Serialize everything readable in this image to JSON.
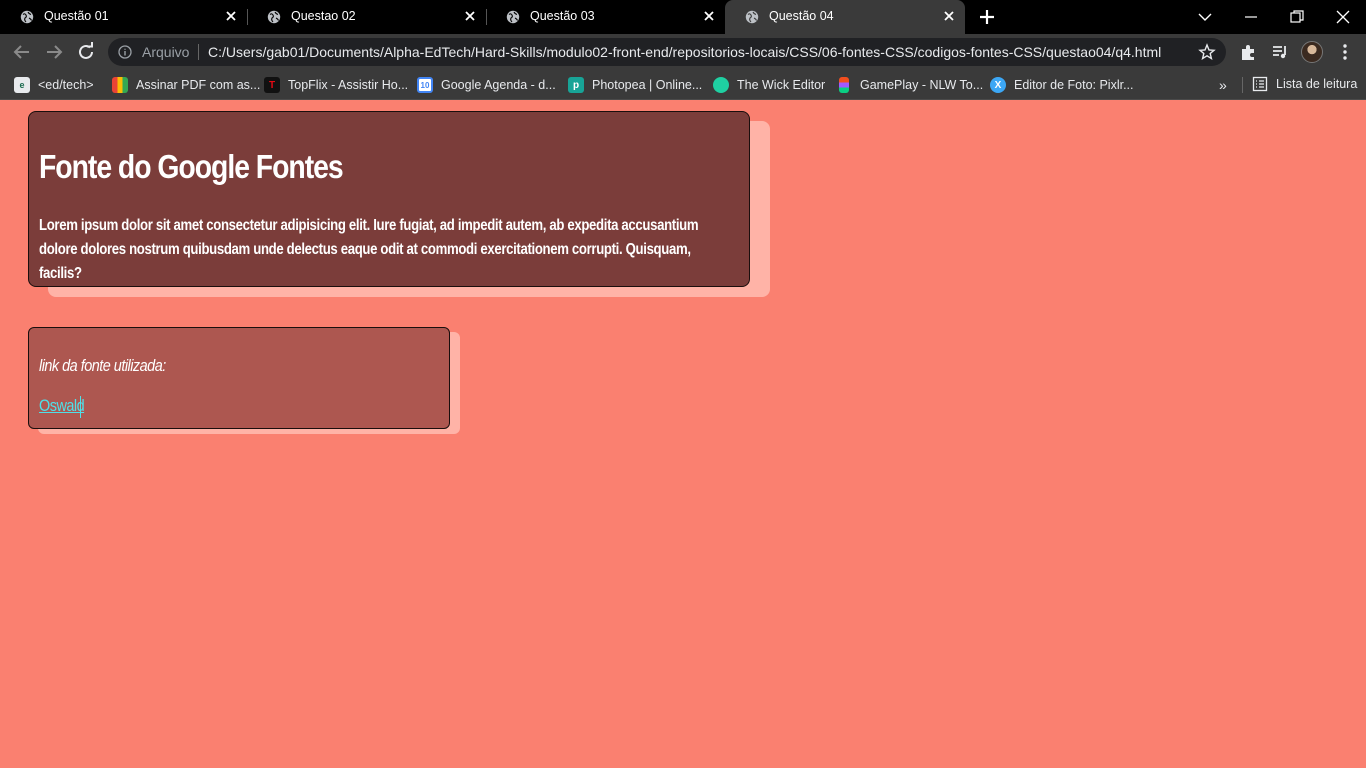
{
  "tabs": [
    {
      "title": "Questão 01",
      "active": false
    },
    {
      "title": "Questao 02",
      "active": false
    },
    {
      "title": "Questão 03",
      "active": false
    },
    {
      "title": "Questão 04",
      "active": true
    }
  ],
  "address_bar": {
    "security_label": "Arquivo",
    "url": "C:/Users/gab01/Documents/Alpha-EdTech/Hard-Skills/modulo02-front-end/repositorios-locais/CSS/06-fontes-CSS/codigos-fontes-CSS/questao04/q4.html"
  },
  "bookmarks": [
    {
      "label": "<ed/tech>",
      "icon": "edtech-icon",
      "color": "#e8eaed"
    },
    {
      "label": "Assinar PDF com as...",
      "icon": "pdf-sign-icon",
      "color": "#f4b400"
    },
    {
      "label": "TopFlix - Assistir Ho...",
      "icon": "topflix-icon",
      "color": "#111111"
    },
    {
      "label": "Google Agenda - d...",
      "icon": "google-calendar-icon",
      "color": "#4285f4"
    },
    {
      "label": "Photopea | Online...",
      "icon": "photopea-icon",
      "color": "#18a497"
    },
    {
      "label": "The Wick Editor",
      "icon": "wick-editor-icon",
      "color": "#1fd0a2"
    },
    {
      "label": "GamePlay - NLW To...",
      "icon": "figma-icon",
      "color": "#f24e1e"
    },
    {
      "label": "Editor de Foto: Pixlr...",
      "icon": "pixlr-icon",
      "color": "#3ca7f5"
    }
  ],
  "reading_list": {
    "label": "Lista de leitura"
  },
  "content": {
    "heading": "Fonte do Google Fontes",
    "paragraph": "Lorem ipsum dolor sit amet consectetur adipisicing elit. Iure fugiat, ad impedit autem, ab expedita accusantium dolore dolores nostrum quibusdam unde delectus eaque odit at commodi exercitationem corrupti. Quisquam, facilis?",
    "link_label": "link da fonte utilizada:",
    "link_text": "Oswald"
  },
  "colors": {
    "page_background": "#fa8070",
    "card_primary": "#7b3d3a",
    "card_secondary": "#ad5750",
    "card_shadow": "#ffb3a7",
    "link": "#4fe0e8"
  }
}
